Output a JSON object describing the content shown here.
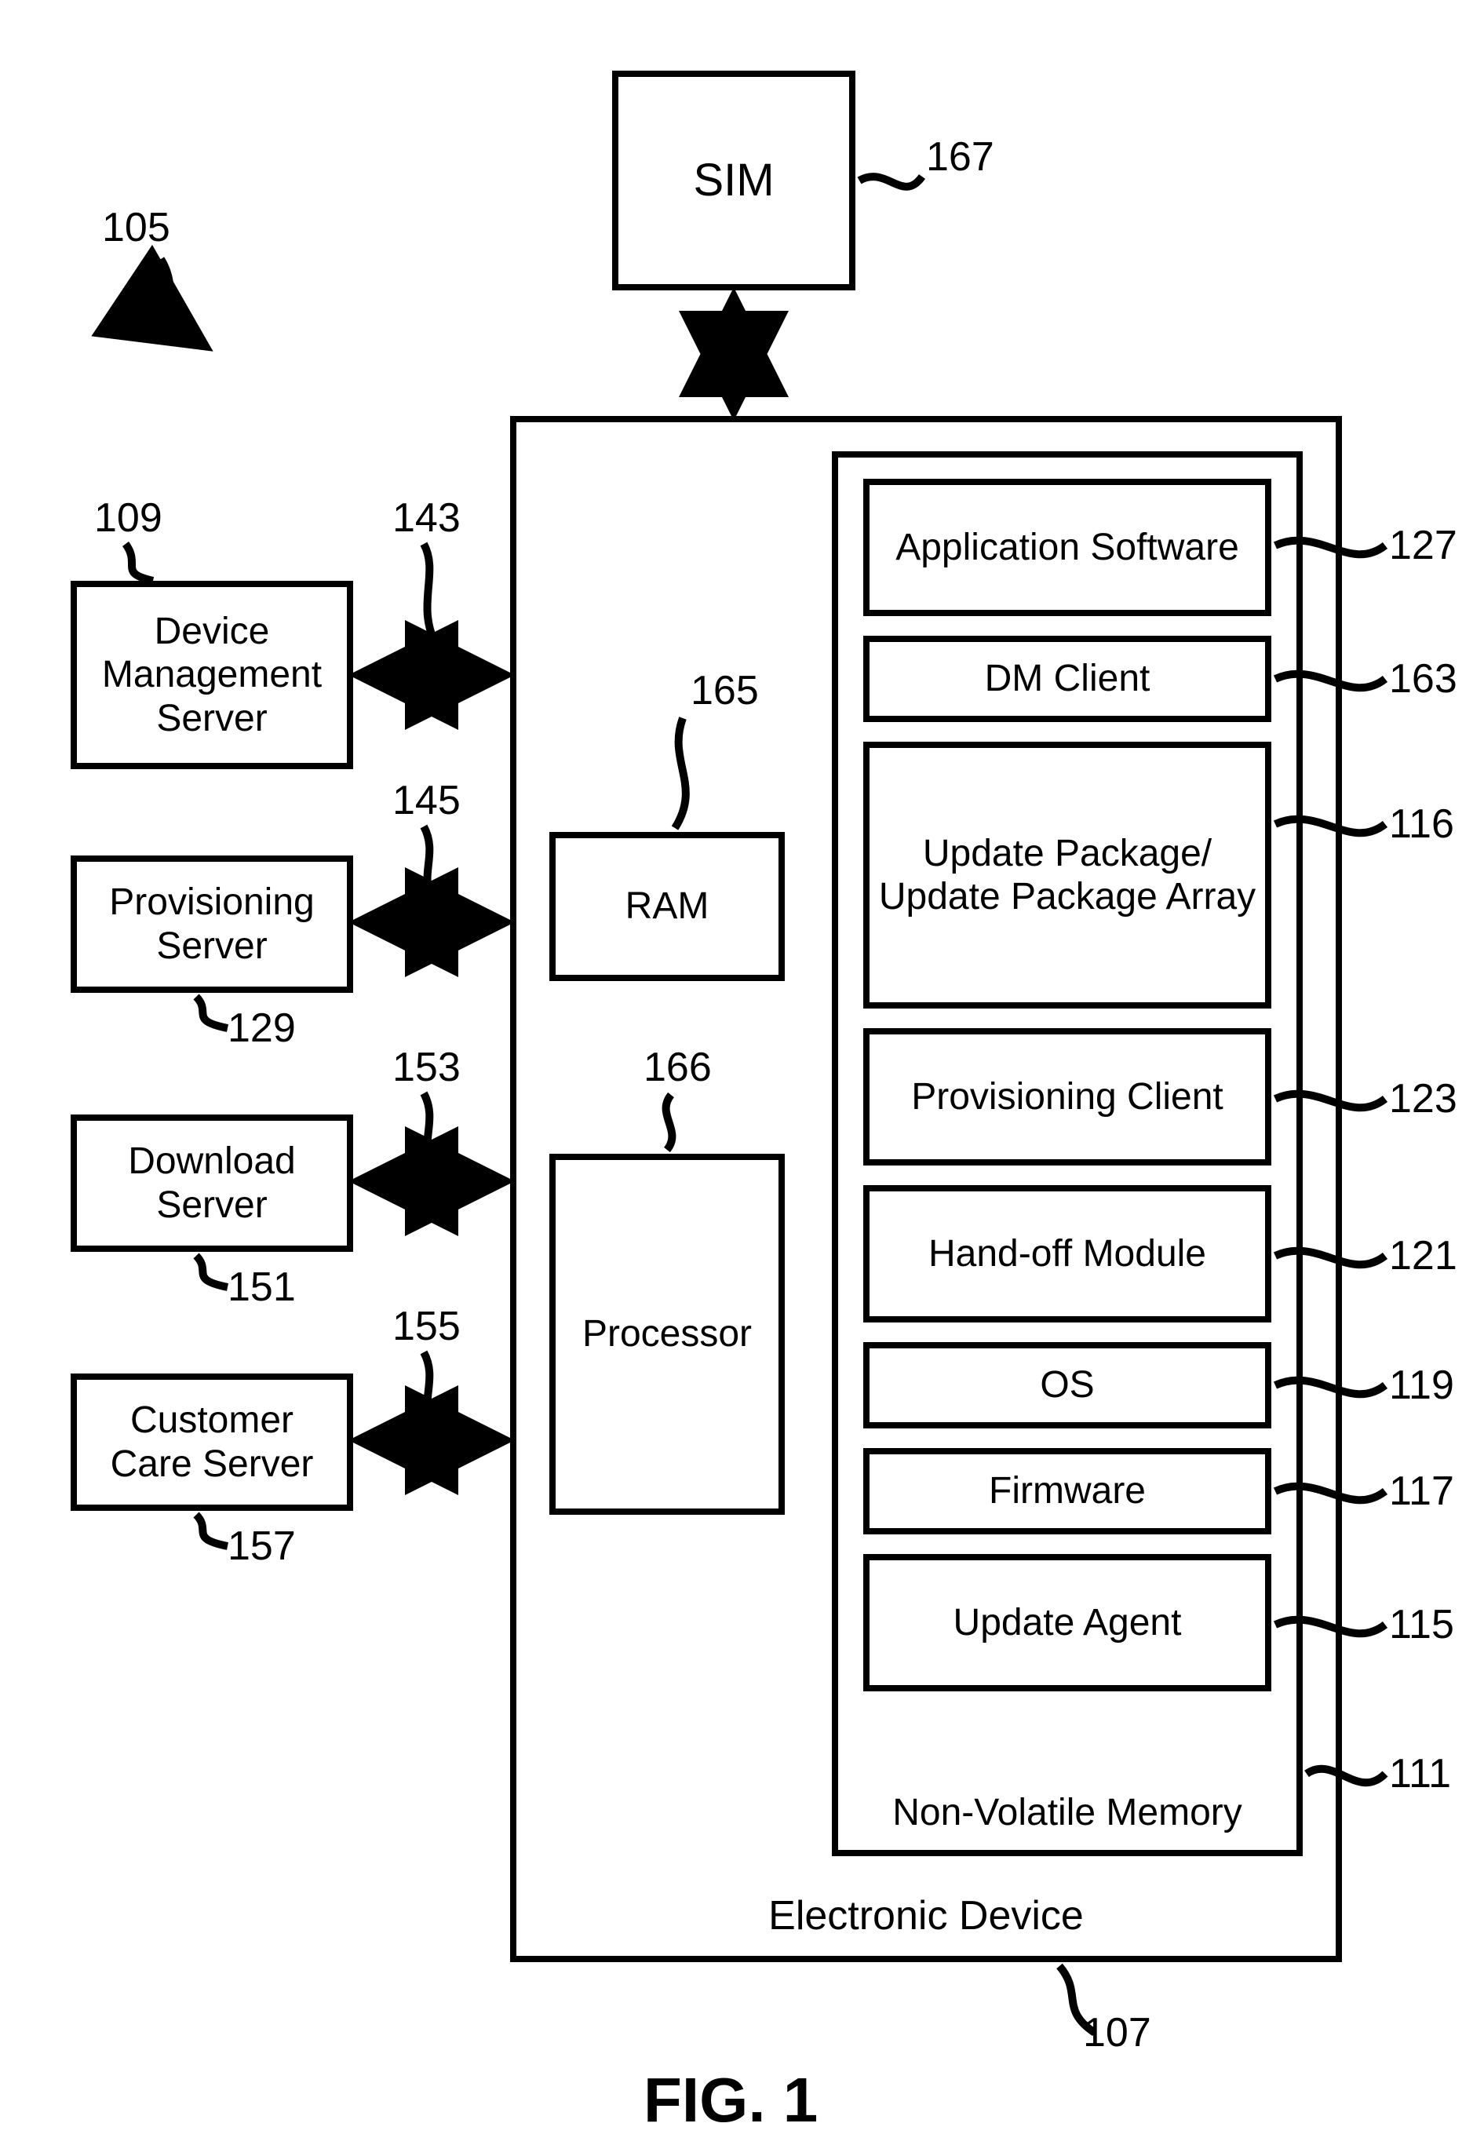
{
  "fig": "FIG. 1",
  "ref": {
    "system": "105",
    "sim": "167",
    "dms": "109",
    "dms_link": "143",
    "prov": "129",
    "prov_link": "145",
    "dl": "151",
    "dl_link": "153",
    "cc": "157",
    "cc_link": "155",
    "ram": "165",
    "proc": "166",
    "app": "127",
    "dmc": "163",
    "upd": "116",
    "provc": "123",
    "hand": "121",
    "os": "119",
    "fw": "117",
    "ua": "115",
    "nvm": "111",
    "device": "107"
  },
  "text": {
    "sim": "SIM",
    "dms": "Device Management Server",
    "prov": "Provisioning Server",
    "dl": "Download Server",
    "cc": "Customer Care Server",
    "ram": "RAM",
    "proc": "Processor",
    "app": "Application Software",
    "dmc": "DM Client",
    "upd": "Update Package/ Update Package Array",
    "provc": "Provisioning Client",
    "hand": "Hand-off Module",
    "os": "OS",
    "fw": "Firmware",
    "ua": "Update Agent",
    "nvm": "Non-Volatile Memory",
    "device": "Electronic Device"
  }
}
